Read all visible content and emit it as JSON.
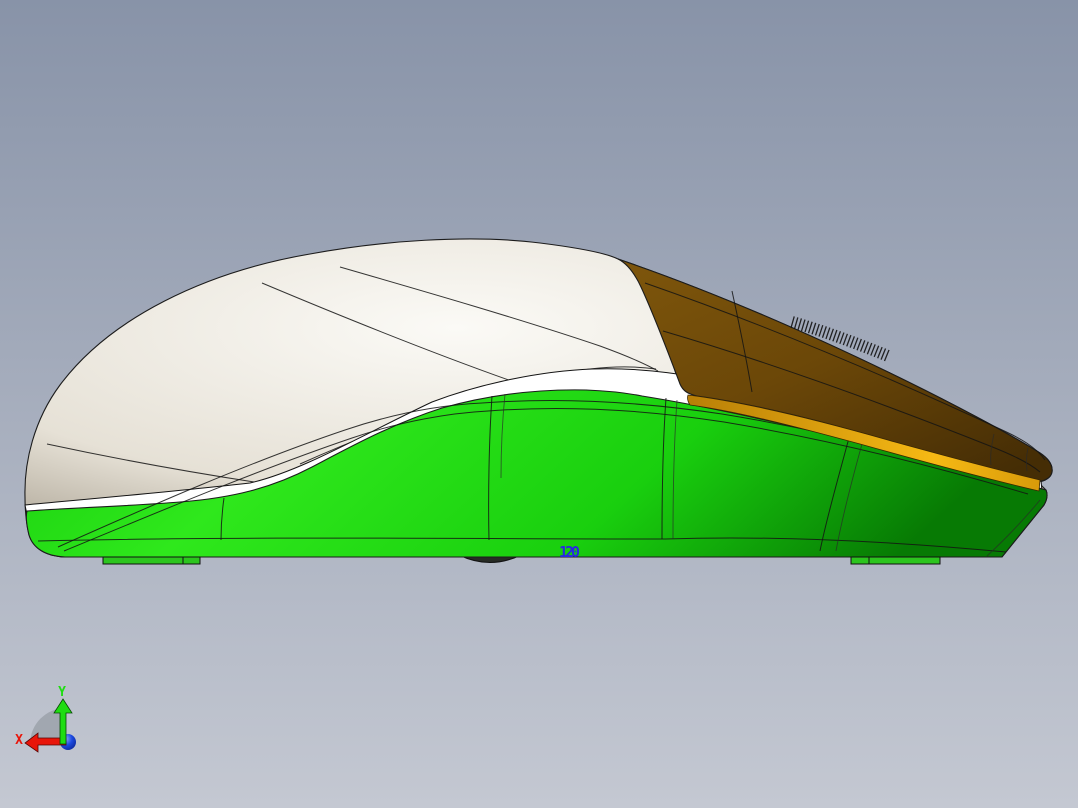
{
  "viewport": {
    "background_top": "#8893a8",
    "background_bottom": "#c4c8d2"
  },
  "model": {
    "colors": {
      "outline": "#1a1a1a",
      "shell_light": "#fbfaf6",
      "shell_mid": "#e6e1d6",
      "shell_dark": "#9d9484",
      "body_green_light": "#2fe81c",
      "body_green_mid": "#19cf0e",
      "body_green_dark": "#077a04",
      "panel_brown_light": "#7e560c",
      "panel_brown_mid": "#6b4708",
      "panel_brown_dark": "#452d05",
      "panel_gold_light": "#f6b914",
      "panel_gold_mid": "#d89a0a",
      "panel_gold_dark": "#b97f07",
      "band_white": "#ffffff",
      "gap_gray": "#c9c9c9",
      "sensor_dark": "#272b25",
      "foot_green": "#2cc51e",
      "wheel_tick": "#161616"
    }
  },
  "dimension_label": {
    "text": "120",
    "color": "#2a2ae0"
  },
  "triad": {
    "fan_color": "#9aa0a9",
    "x_axis": {
      "label": "X",
      "color": "#e8150a"
    },
    "y_axis": {
      "label": "Y",
      "color": "#1fdd12"
    },
    "origin": {
      "color": "#1c4ae0"
    }
  }
}
